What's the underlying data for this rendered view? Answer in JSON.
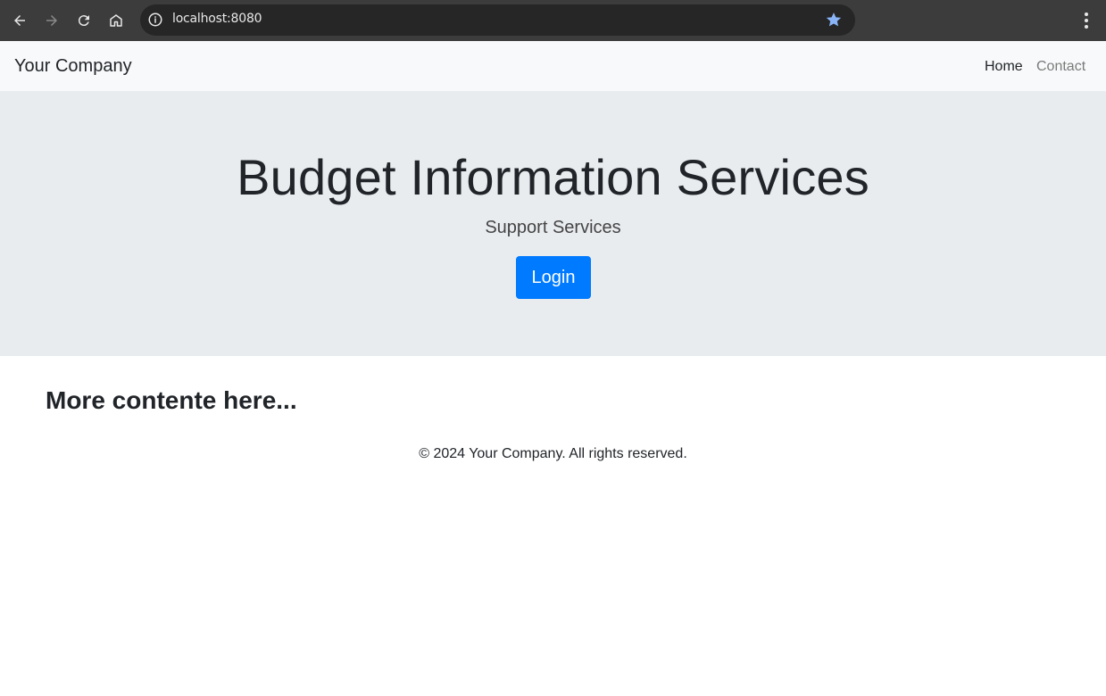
{
  "browser": {
    "url": "localhost:8080",
    "icons": [
      "back-icon",
      "forward-icon",
      "reload-icon",
      "home-icon",
      "info-icon",
      "star-icon",
      "menu-icon"
    ],
    "accent": "#8ab4f8"
  },
  "navbar": {
    "brand": "Your Company",
    "links": [
      {
        "label": "Home",
        "active": true
      },
      {
        "label": "Contact",
        "active": false
      }
    ]
  },
  "jumbotron": {
    "title": "Budget Information Services",
    "subtitle": "Support Services",
    "login_label": "Login",
    "button_color": "#007bff"
  },
  "content": {
    "heading": "More contente here..."
  },
  "footer": {
    "text": "© 2024 Your Company. All rights reserved."
  }
}
